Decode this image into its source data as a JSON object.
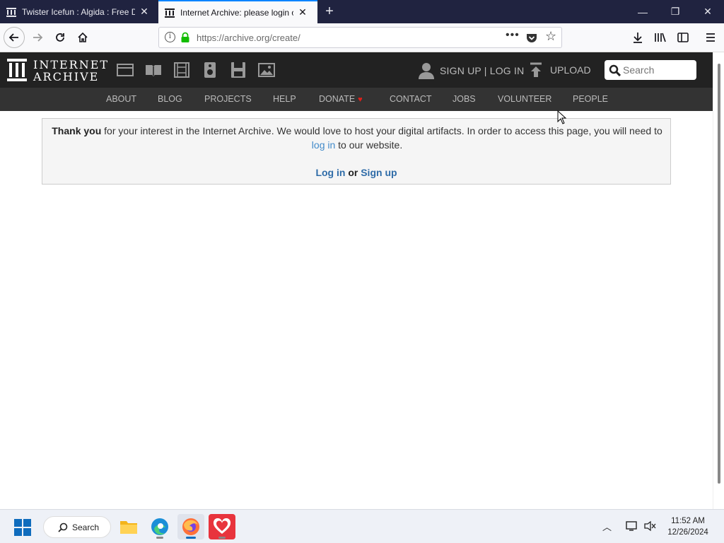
{
  "browser": {
    "tabs": [
      {
        "title": "Twister Icefun : Algida : Free Do",
        "active": false
      },
      {
        "title": "Internet Archive: please login o",
        "active": true
      }
    ],
    "url_domain": "https://archive.org",
    "url_path": "/create/",
    "accent_color": "#0a84ff"
  },
  "header": {
    "logo_line1": "INTERNET",
    "logo_line2": "ARCHIVE",
    "media_icons": [
      "web-icon",
      "texts-icon",
      "video-icon",
      "audio-icon",
      "software-icon",
      "images-icon"
    ],
    "signup_login": "SIGN UP | LOG IN",
    "upload": "UPLOAD",
    "search_placeholder": "Search"
  },
  "nav": {
    "items": [
      "ABOUT",
      "BLOG",
      "PROJECTS",
      "HELP",
      "DONATE",
      "CONTACT",
      "JOBS",
      "VOLUNTEER",
      "PEOPLE"
    ]
  },
  "notice": {
    "bold_lead": "Thank you",
    "text1": " for your interest in the Internet Archive. We would love to host your digital artifacts. In order to access this page, you will need to ",
    "login_link": "log in",
    "text2": " to our website.",
    "action_login": "Log in",
    "action_or": " or ",
    "action_signup": "Sign up"
  },
  "taskbar": {
    "search_label": "Search",
    "time": "11:52 AM",
    "date": "12/26/2024"
  }
}
